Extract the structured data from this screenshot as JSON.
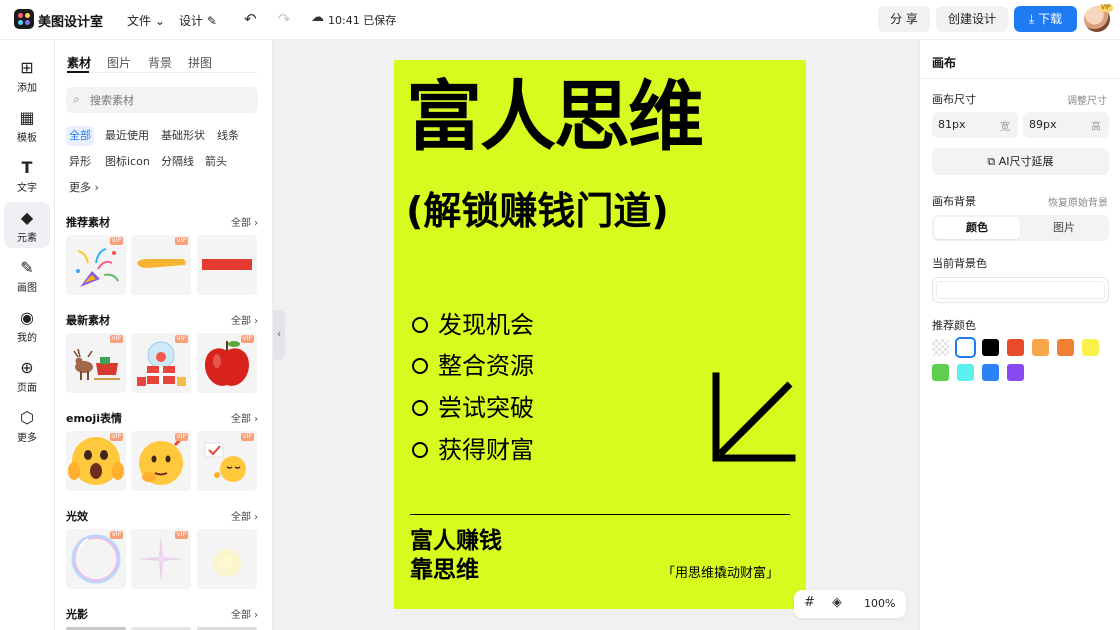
{
  "header": {
    "app_name": "美图设计室",
    "menu_file": "文件",
    "menu_design": "设计",
    "save_status": "10:41 已保存",
    "share_label": "分 享",
    "create_label": "创建设计",
    "download_label": "下载",
    "avatar_badge": "VIP"
  },
  "rail": {
    "items": [
      {
        "label": "添加",
        "icon": "plus-square-icon"
      },
      {
        "label": "模板",
        "icon": "template-icon"
      },
      {
        "label": "文字",
        "icon": "text-icon"
      },
      {
        "label": "元素",
        "icon": "elements-icon"
      },
      {
        "label": "画图",
        "icon": "draw-icon"
      },
      {
        "label": "我的",
        "icon": "user-icon"
      },
      {
        "label": "页面",
        "icon": "page-icon"
      },
      {
        "label": "更多",
        "icon": "more-cube-icon"
      }
    ],
    "active_item": "元素"
  },
  "material_panel": {
    "tabs": [
      "素材",
      "图片",
      "背景",
      "拼图"
    ],
    "active_tab": "素材",
    "search_placeholder": "搜索素材",
    "chips": [
      "全部",
      "最近使用",
      "基础形状",
      "线条",
      "异形",
      "图标icon",
      "分隔线",
      "箭头",
      "更多"
    ],
    "active_chip": "全部",
    "vip_label": "VIP",
    "sections": [
      {
        "title": "推荐素材",
        "more": "全部",
        "items": [
          "party-popper",
          "yellow-brush-stroke",
          "red-bar"
        ]
      },
      {
        "title": "最新素材",
        "more": "全部",
        "items": [
          "reindeer-sleigh",
          "christmas-gift-globe",
          "red-apple"
        ]
      },
      {
        "title": "emoji表情",
        "more": "全部",
        "items": [
          "screaming-face-emoji",
          "thinking-face-emoji",
          "sleepy-emoji"
        ]
      },
      {
        "title": "光效",
        "more": "全部",
        "items": [
          "bubble-ring",
          "pink-star-sparkle",
          "yellow-glow"
        ]
      },
      {
        "title": "光影",
        "more": "全部",
        "items": []
      }
    ]
  },
  "poster": {
    "background_color": "#d6fb1f",
    "title": "富人思维",
    "subtitle": "(解锁赚钱门道)",
    "list_items": [
      "发现机会",
      "整合资源",
      "尝试突破",
      "获得财富"
    ],
    "footer_line1": "富人赚钱",
    "footer_line2": "靠思维",
    "slogan": "「用思维撬动财富」",
    "arrow_icon": "arrow-down-left-icon"
  },
  "zoom_toolbar": {
    "zoom_level": "100%"
  },
  "right_panel": {
    "title": "画布",
    "size_label": "画布尺寸",
    "adjust_size_link": "调整尺寸",
    "width_value": "81px",
    "width_unit": "宽",
    "height_value": "89px",
    "height_unit": "高",
    "ai_extend_label": "AI尺寸延展",
    "background_label": "画布背景",
    "restore_bg_link": "恢复原始背景",
    "seg_color": "颜色",
    "seg_image": "图片",
    "current_bg_label": "当前背景色",
    "current_bg_color": "#ffffff",
    "recommend_label": "推荐颜色",
    "colors": [
      "transparent",
      "#ffffff",
      "#000000",
      "#e94b2a",
      "#f5a54a",
      "#f08033",
      "#f9f04a",
      "#5dcf4f",
      "#5af0ed",
      "#2b82f3",
      "#8849f0"
    ],
    "selected_color": "#ffffff"
  }
}
